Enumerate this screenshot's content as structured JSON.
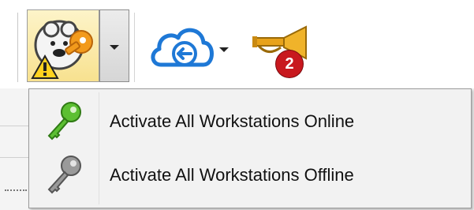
{
  "toolbar": {
    "license_button": {
      "icon": "license-warning-key-icon",
      "has_dropdown": true
    },
    "cloud_button": {
      "icon": "cloud-sync-icon",
      "has_dropdown": true
    },
    "notifications_button": {
      "icon": "trumpet-icon",
      "badge_count": "2"
    }
  },
  "menu": {
    "items": [
      {
        "label": "Activate All Workstations Online",
        "icon": "green-key-icon",
        "icon_color": "#4caf2a"
      },
      {
        "label": "Activate All Workstations Offline",
        "icon": "gray-key-icon",
        "icon_color": "#8a8a8a"
      }
    ]
  }
}
